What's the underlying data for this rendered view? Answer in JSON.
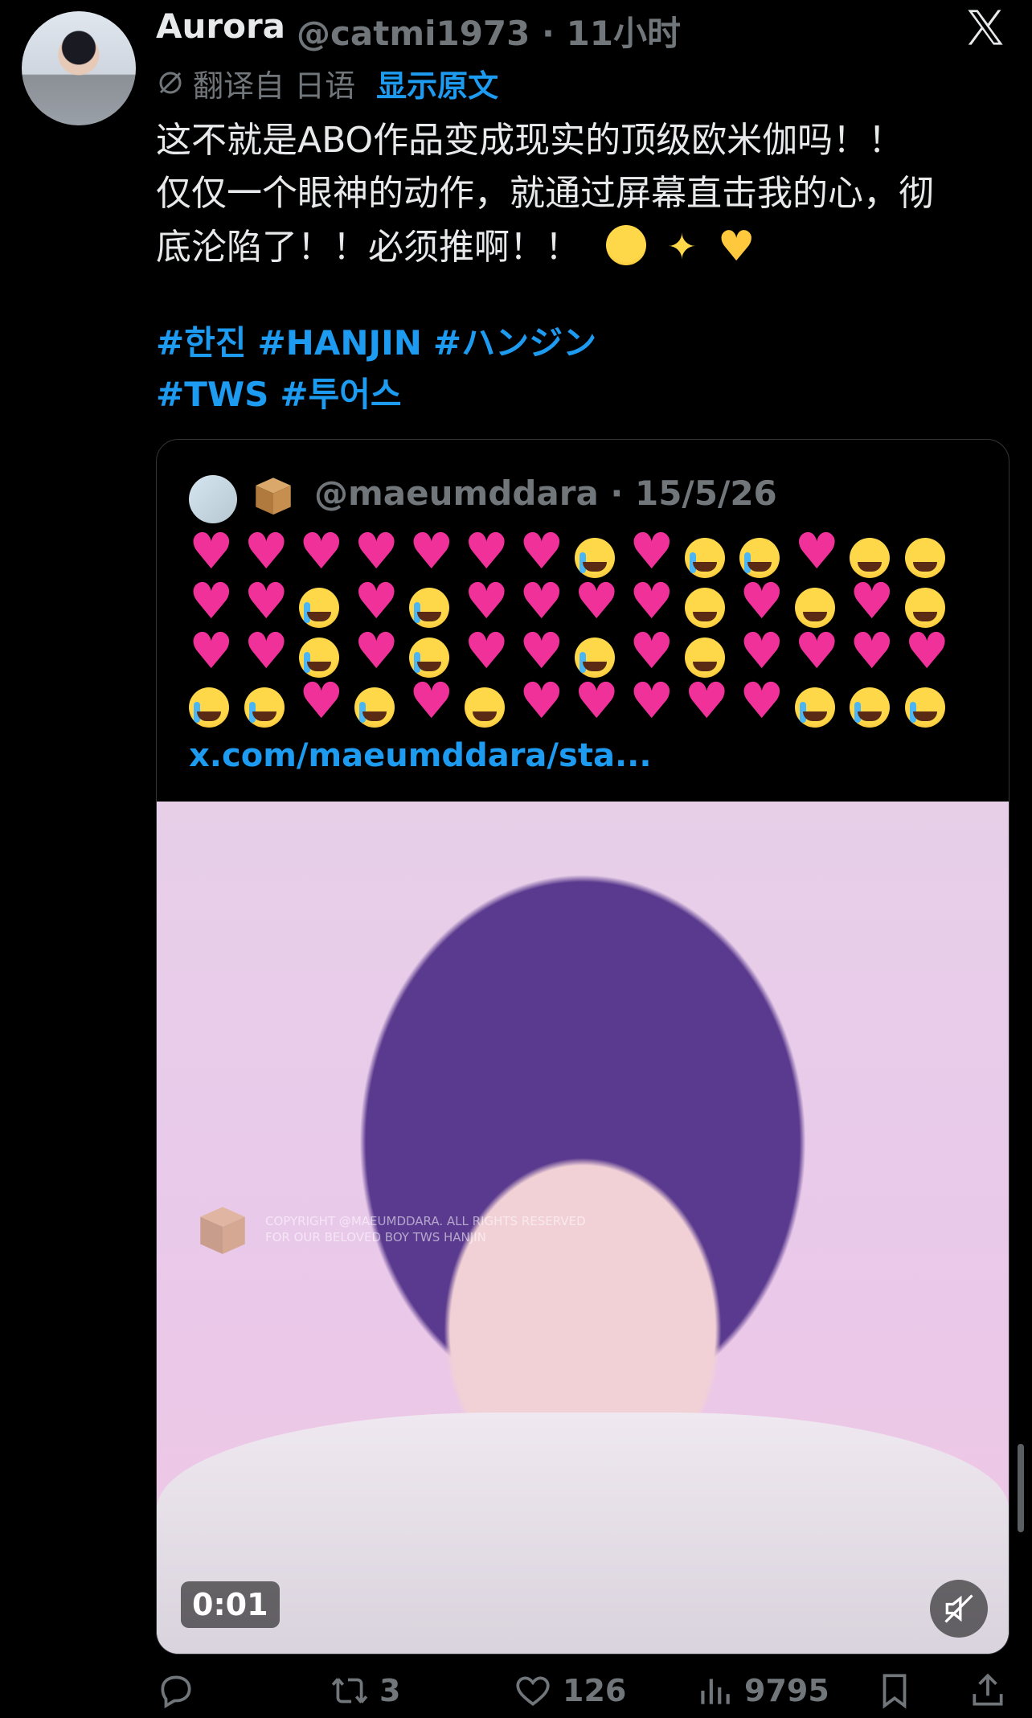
{
  "tweet": {
    "display_name": "Aurora",
    "handle_time": "@catmi1973 · 11小时",
    "translation": {
      "prefix": "翻译自 日语",
      "show_original": "显示原文"
    },
    "body_lines": [
      "这不就是ABO作品变成现实的顶级欧米伽吗！！",
      "仅仅一个眼神的动作，就通过屏幕直击我的心，彻",
      "底沦陷了！！必须推啊！！"
    ],
    "hashtags_line1": [
      "#한진",
      "#HANJIN",
      "#ハンジン"
    ],
    "hashtags_line2": [
      "#TWS",
      "#투어스"
    ]
  },
  "quote": {
    "handle_date": "@maeumddara · 15/5/26",
    "link": "x.com/maeumddara/sta...",
    "emoji_rows": [
      [
        "heart",
        "heart",
        "heart",
        "heart",
        "heart",
        "heart",
        "heart",
        "cry",
        "heart",
        "cry",
        "cry",
        "heart",
        "face",
        "face"
      ],
      [
        "heart",
        "heart",
        "cry",
        "heart",
        "cry",
        "heart",
        "heart",
        "heart",
        "heart",
        "face",
        "heart",
        "face",
        "heart",
        "face"
      ],
      [
        "heart",
        "heart",
        "cry",
        "heart",
        "cry",
        "heart",
        "heart",
        "cry",
        "heart",
        "face",
        "heart",
        "heart",
        "heart",
        "heart"
      ],
      [
        "cry",
        "cry",
        "heart",
        "cry",
        "heart",
        "face",
        "heart",
        "heart",
        "heart",
        "heart",
        "heart",
        "cry",
        "cry",
        "cry"
      ]
    ],
    "video": {
      "timer": "0:01",
      "watermark_line1": "COPYRIGHT @MAEUMDDARA. ALL RIGHTS RESERVED",
      "watermark_line2": "FOR OUR BELOVED BOY TWS HANJIN"
    }
  },
  "actions": {
    "retweets": "3",
    "likes": "126",
    "views": "9795"
  },
  "colors": {
    "background": "#000000",
    "text": "#e7e9ea",
    "muted": "#71767b",
    "link": "#1d9bf0",
    "heart": "#f0319a"
  }
}
